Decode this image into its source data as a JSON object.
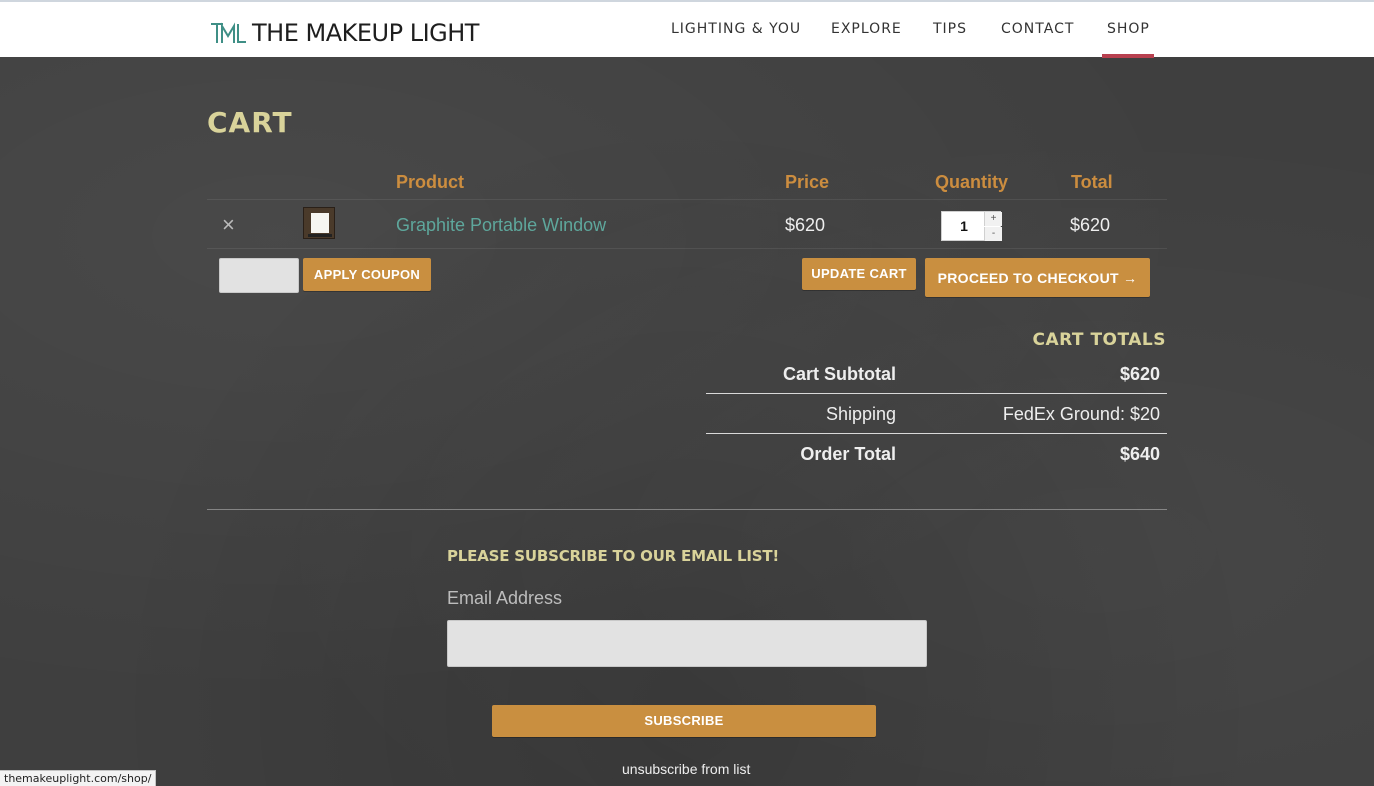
{
  "header": {
    "logo_text": "THE MAKEUP LIGHT",
    "nav": [
      "LIGHTING & YOU",
      "EXPLORE",
      "TIPS",
      "CONTACT",
      "SHOP"
    ],
    "active_nav": "SHOP"
  },
  "cart": {
    "title": "CART",
    "columns": {
      "product": "Product",
      "price": "Price",
      "quantity": "Quantity",
      "total": "Total"
    },
    "items": [
      {
        "remove_icon": "×",
        "name": "Graphite Portable Window",
        "price": "$620",
        "quantity": "1",
        "qty_plus": "+",
        "qty_minus": "-",
        "total": "$620"
      }
    ],
    "coupon_placeholder": "",
    "apply_coupon_label": "APPLY COUPON",
    "update_cart_label": "UPDATE CART",
    "checkout_label": "PROCEED TO CHECKOUT →"
  },
  "totals": {
    "title": "CART TOTALS",
    "subtotal_label": "Cart Subtotal",
    "subtotal_value": "$620",
    "shipping_label": "Shipping",
    "shipping_value": "FedEx Ground: $20",
    "order_total_label": "Order Total",
    "order_total_value": "$640"
  },
  "subscribe": {
    "title": "PLEASE SUBSCRIBE TO OUR EMAIL LIST!",
    "email_label": "Email Address",
    "email_value": "",
    "button_label": "SUBSCRIBE",
    "unsubscribe_label": "unsubscribe from list"
  },
  "status_bar": {
    "url": "themakeuplight.com/shop/"
  },
  "colors": {
    "accent": "#c98f40",
    "heading": "#d9d39a",
    "link": "#5ea79c",
    "active_nav_underline": "#b8404f",
    "background": "#3f3f3f"
  },
  "icons": {
    "logo": "tml-monogram-icon",
    "remove": "close-icon"
  }
}
